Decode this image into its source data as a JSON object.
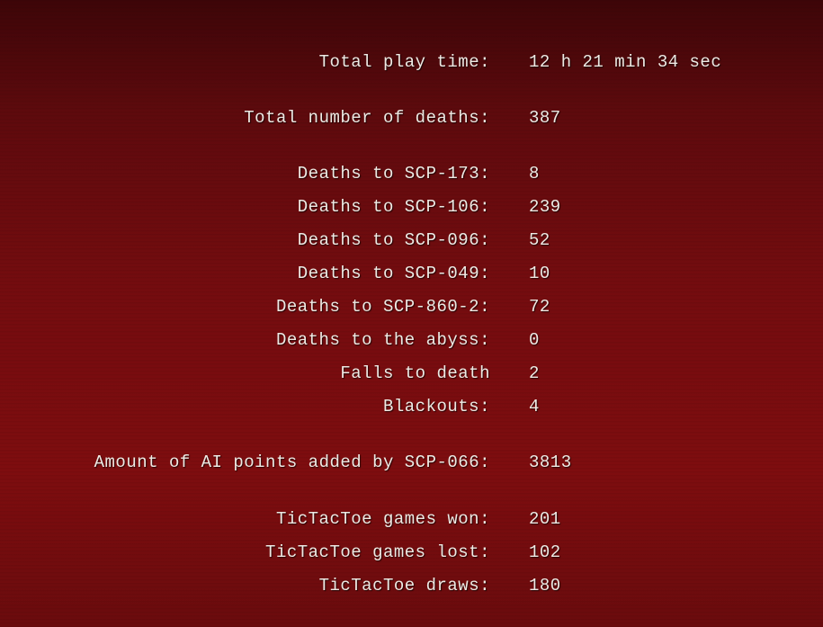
{
  "stats": [
    {
      "label": "Total play time:",
      "value": "12 h 21 min 34 sec"
    },
    {
      "label": "Total number of deaths:",
      "value": "387"
    },
    {
      "label": "Deaths to SCP-173:",
      "value": "8"
    },
    {
      "label": "Deaths to SCP-106:",
      "value": "239"
    },
    {
      "label": "Deaths to SCP-096:",
      "value": "52"
    },
    {
      "label": "Deaths to SCP-049:",
      "value": "10"
    },
    {
      "label": "Deaths to SCP-860-2:",
      "value": "72"
    },
    {
      "label": "Deaths to the abyss:",
      "value": "0"
    },
    {
      "label": "Falls to death",
      "value": "2"
    },
    {
      "label": "Blackouts:",
      "value": "4"
    },
    {
      "label": "Amount of AI points added by SCP-066:",
      "value": "3813"
    },
    {
      "label": "TicTacToe games won:",
      "value": "201"
    },
    {
      "label": "TicTacToe games lost:",
      "value": "102"
    },
    {
      "label": "TicTacToe draws:",
      "value": "180"
    }
  ]
}
